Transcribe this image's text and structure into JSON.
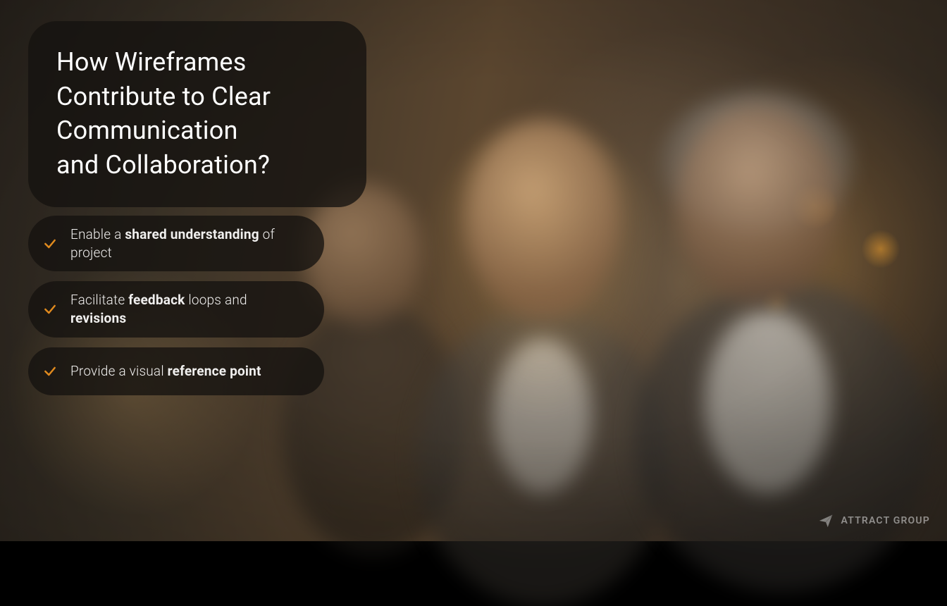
{
  "colors": {
    "accent": "#e08a1e",
    "panel": "rgba(20,18,16,0.78)",
    "text": "#ffffff"
  },
  "title": {
    "line1": "How Wireframes",
    "line2": "Contribute to Clear",
    "line3": "Communication",
    "line4": "and Collaboration?"
  },
  "bullets": [
    {
      "pre": "Enable a ",
      "b1": "shared understanding",
      "mid": " of project",
      "b2": "",
      "post": ""
    },
    {
      "pre": "Facilitate ",
      "b1": "feedback",
      "mid": " loops and ",
      "b2": "revisions",
      "post": ""
    },
    {
      "pre": "Provide a visual ",
      "b1": "reference point",
      "mid": "",
      "b2": "",
      "post": ""
    }
  ],
  "brand": {
    "name": "ATTRACT GROUP"
  }
}
